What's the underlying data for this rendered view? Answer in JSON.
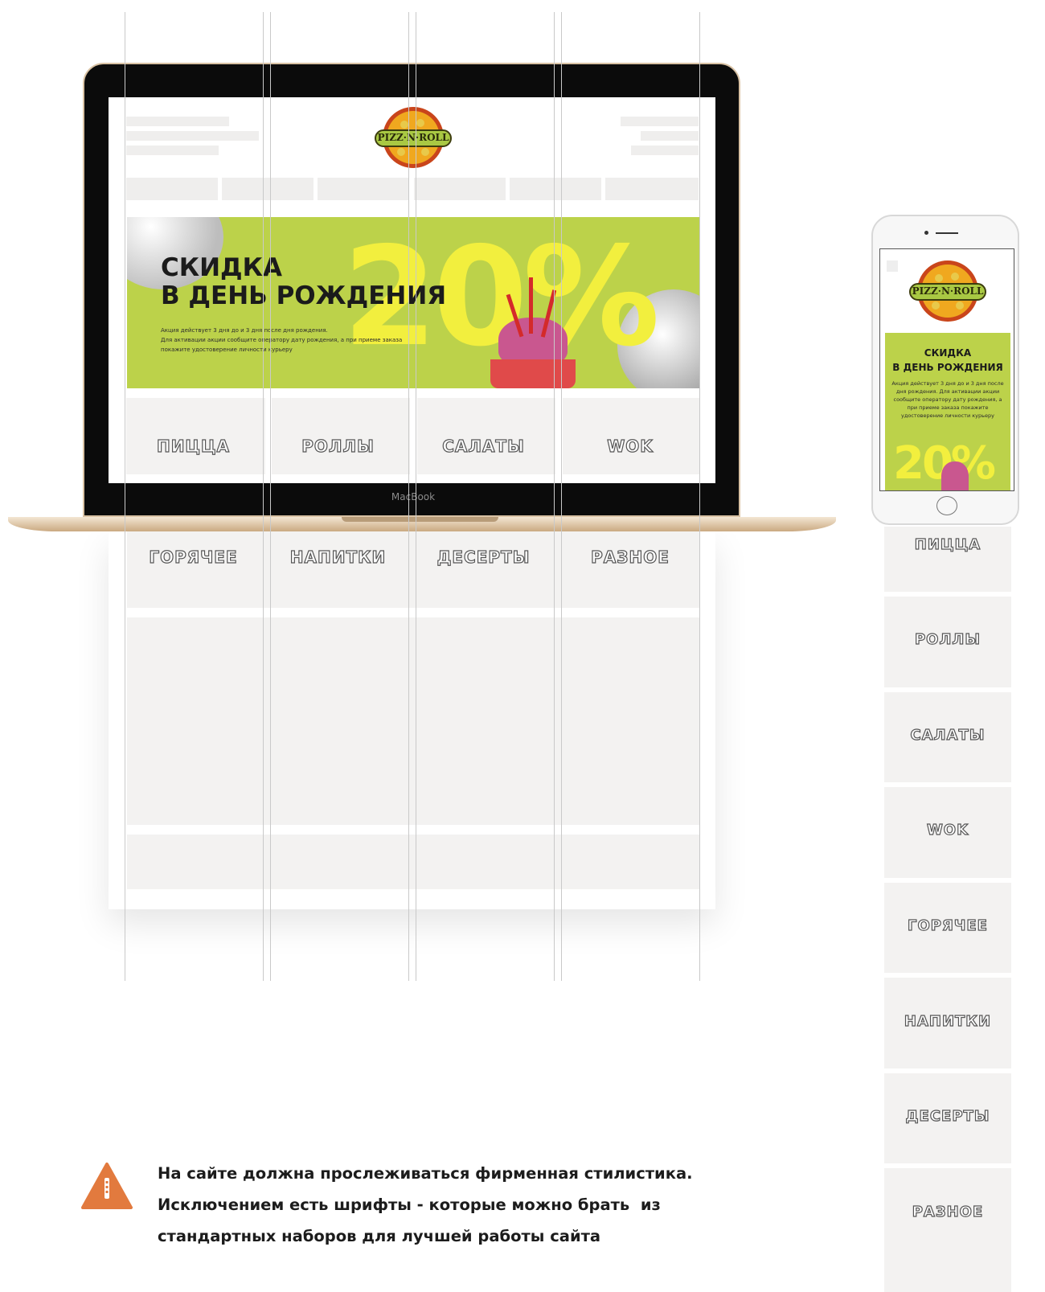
{
  "site": {
    "logo_text": "PIZZ·N·ROLL",
    "brand_color": "#bcd24a",
    "accent_color": "#f2ef3e"
  },
  "laptop": {
    "brand_label": "MacBook"
  },
  "hero": {
    "title_line1": "СКИДКА",
    "title_line2": "В ДЕНЬ РОЖДЕНИЯ",
    "note_line1": "Акция действует 3 дня до и 3 дня после дня рождения.",
    "note_line2": "Для активации акции сообщите оператору дату рождения, а при приеме заказа",
    "note_line3": "покажите удостоверение личности курьеру",
    "big_text": "20%"
  },
  "categories": {
    "row1": [
      "ПИЦЦА",
      "РОЛЛЫ",
      "САЛАТЫ",
      "WOK"
    ],
    "row2": [
      "ГОРЯЧЕЕ",
      "НАПИТКИ",
      "ДЕСЕРТЫ",
      "РАЗНОЕ"
    ]
  },
  "phone": {
    "logo_text": "PIZZ·N·ROLL",
    "hero_title_line1": "СКИДКА",
    "hero_title_line2": "В ДЕНЬ РОЖДЕНИЯ",
    "hero_note": "Акция действует 3 дня до и 3 дня после дня рождения. Для активации акции сообщите оператору дату рождения, а при приеме заказа покажите удостоверение личности курьеру",
    "big_text": "20%",
    "categories": [
      "ПИЦЦА",
      "РОЛЛЫ",
      "САЛАТЫ",
      "WOK",
      "ГОРЯЧЕЕ",
      "НАПИТКИ",
      "ДЕСЕРТЫ",
      "РАЗНОЕ"
    ]
  },
  "notice": {
    "icon": "warning-triangle-icon",
    "line1": "На сайте должна прослеживаться фирменная стилистика.",
    "line2": "Исключением есть шрифты - которые можно брать  из",
    "line3": "стандартных наборов для лучшей работы сайта"
  }
}
